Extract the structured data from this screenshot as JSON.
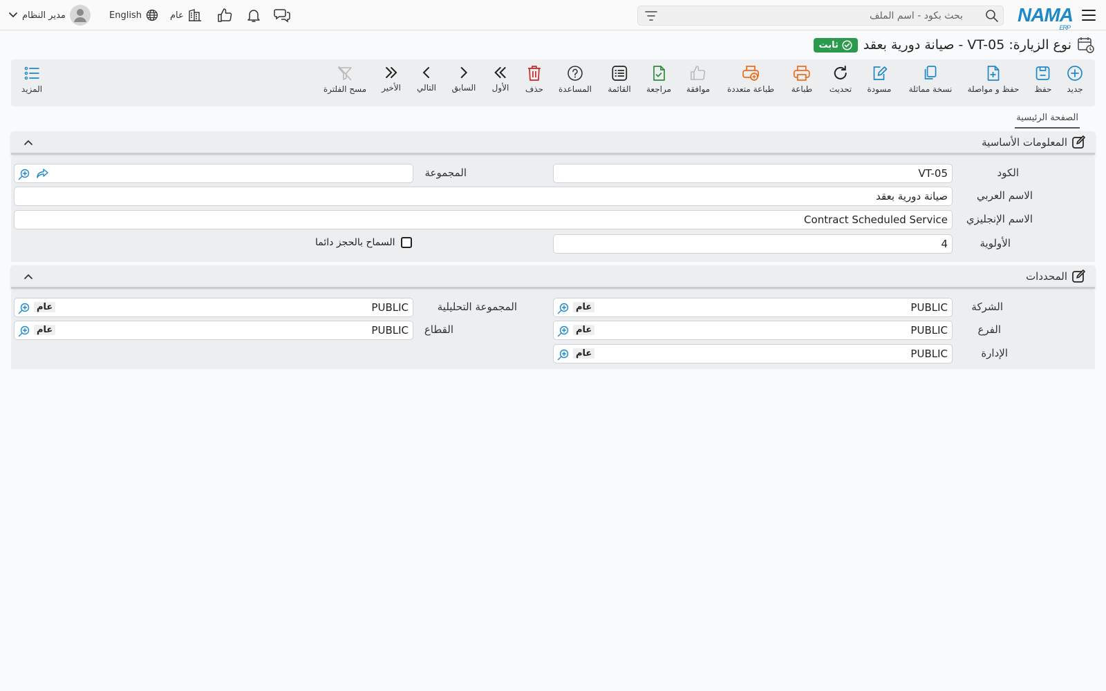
{
  "header": {
    "logo": "NAMA",
    "logo_sub": "ERP",
    "search_placeholder": "بحث بكود - اسم الملف",
    "language": "English",
    "branch_label": "عام",
    "user_name": "مدير النظام"
  },
  "title": {
    "text": "نوع الزيارة: VT-05 - صيانة دورية بعقد",
    "status": "ثابت"
  },
  "toolbar": {
    "new": "جديد",
    "save": "حفظ",
    "save_continue": "حفظ و مواصلة",
    "duplicate": "نسخة مماثلة",
    "draft": "مسودة",
    "refresh": "تحديث",
    "print": "طباعة",
    "multi_print": "طباعة متعددة",
    "approve": "موافقة",
    "review": "مراجعة",
    "list": "القائمة",
    "help": "المساعدة",
    "delete": "حذف",
    "first": "الأول",
    "previous": "السابق",
    "next": "التالي",
    "last": "الأخير",
    "clear_filter": "مسح الفلترة",
    "more": "المزيد"
  },
  "tabs": {
    "main": "الصفحة الرئيسية"
  },
  "basic_info": {
    "title": "المعلومات الأساسية",
    "code_label": "الكود",
    "code_value": "VT-05",
    "group_label": "المجموعة",
    "arabic_name_label": "الاسم العربي",
    "arabic_name_value": "صيانة دورية بعقد",
    "english_name_label": "الاسم الإنجليزي",
    "english_name_value": "Contract Scheduled Service",
    "priority_label": "الأولوية",
    "priority_value": "4",
    "allow_booking_label": "السماح بالحجز دائما"
  },
  "dimensions": {
    "title": "المحددات",
    "company_label": "الشركة",
    "company_value": "PUBLIC",
    "company_tag": "عام",
    "analytic_group_label": "المجموعة التحليلية",
    "analytic_group_value": "PUBLIC",
    "analytic_group_tag": "عام",
    "branch_label": "الفرع",
    "branch_value": "PUBLIC",
    "branch_tag": "عام",
    "sector_label": "القطاع",
    "sector_value": "PUBLIC",
    "sector_tag": "عام",
    "department_label": "الإدارة",
    "department_value": "PUBLIC",
    "department_tag": "عام"
  },
  "colors": {
    "blue": "#1e88c8",
    "orange": "#ef6c1a",
    "red": "#c62828",
    "green": "#2e8b3e",
    "badge": "#2b9a4c"
  }
}
